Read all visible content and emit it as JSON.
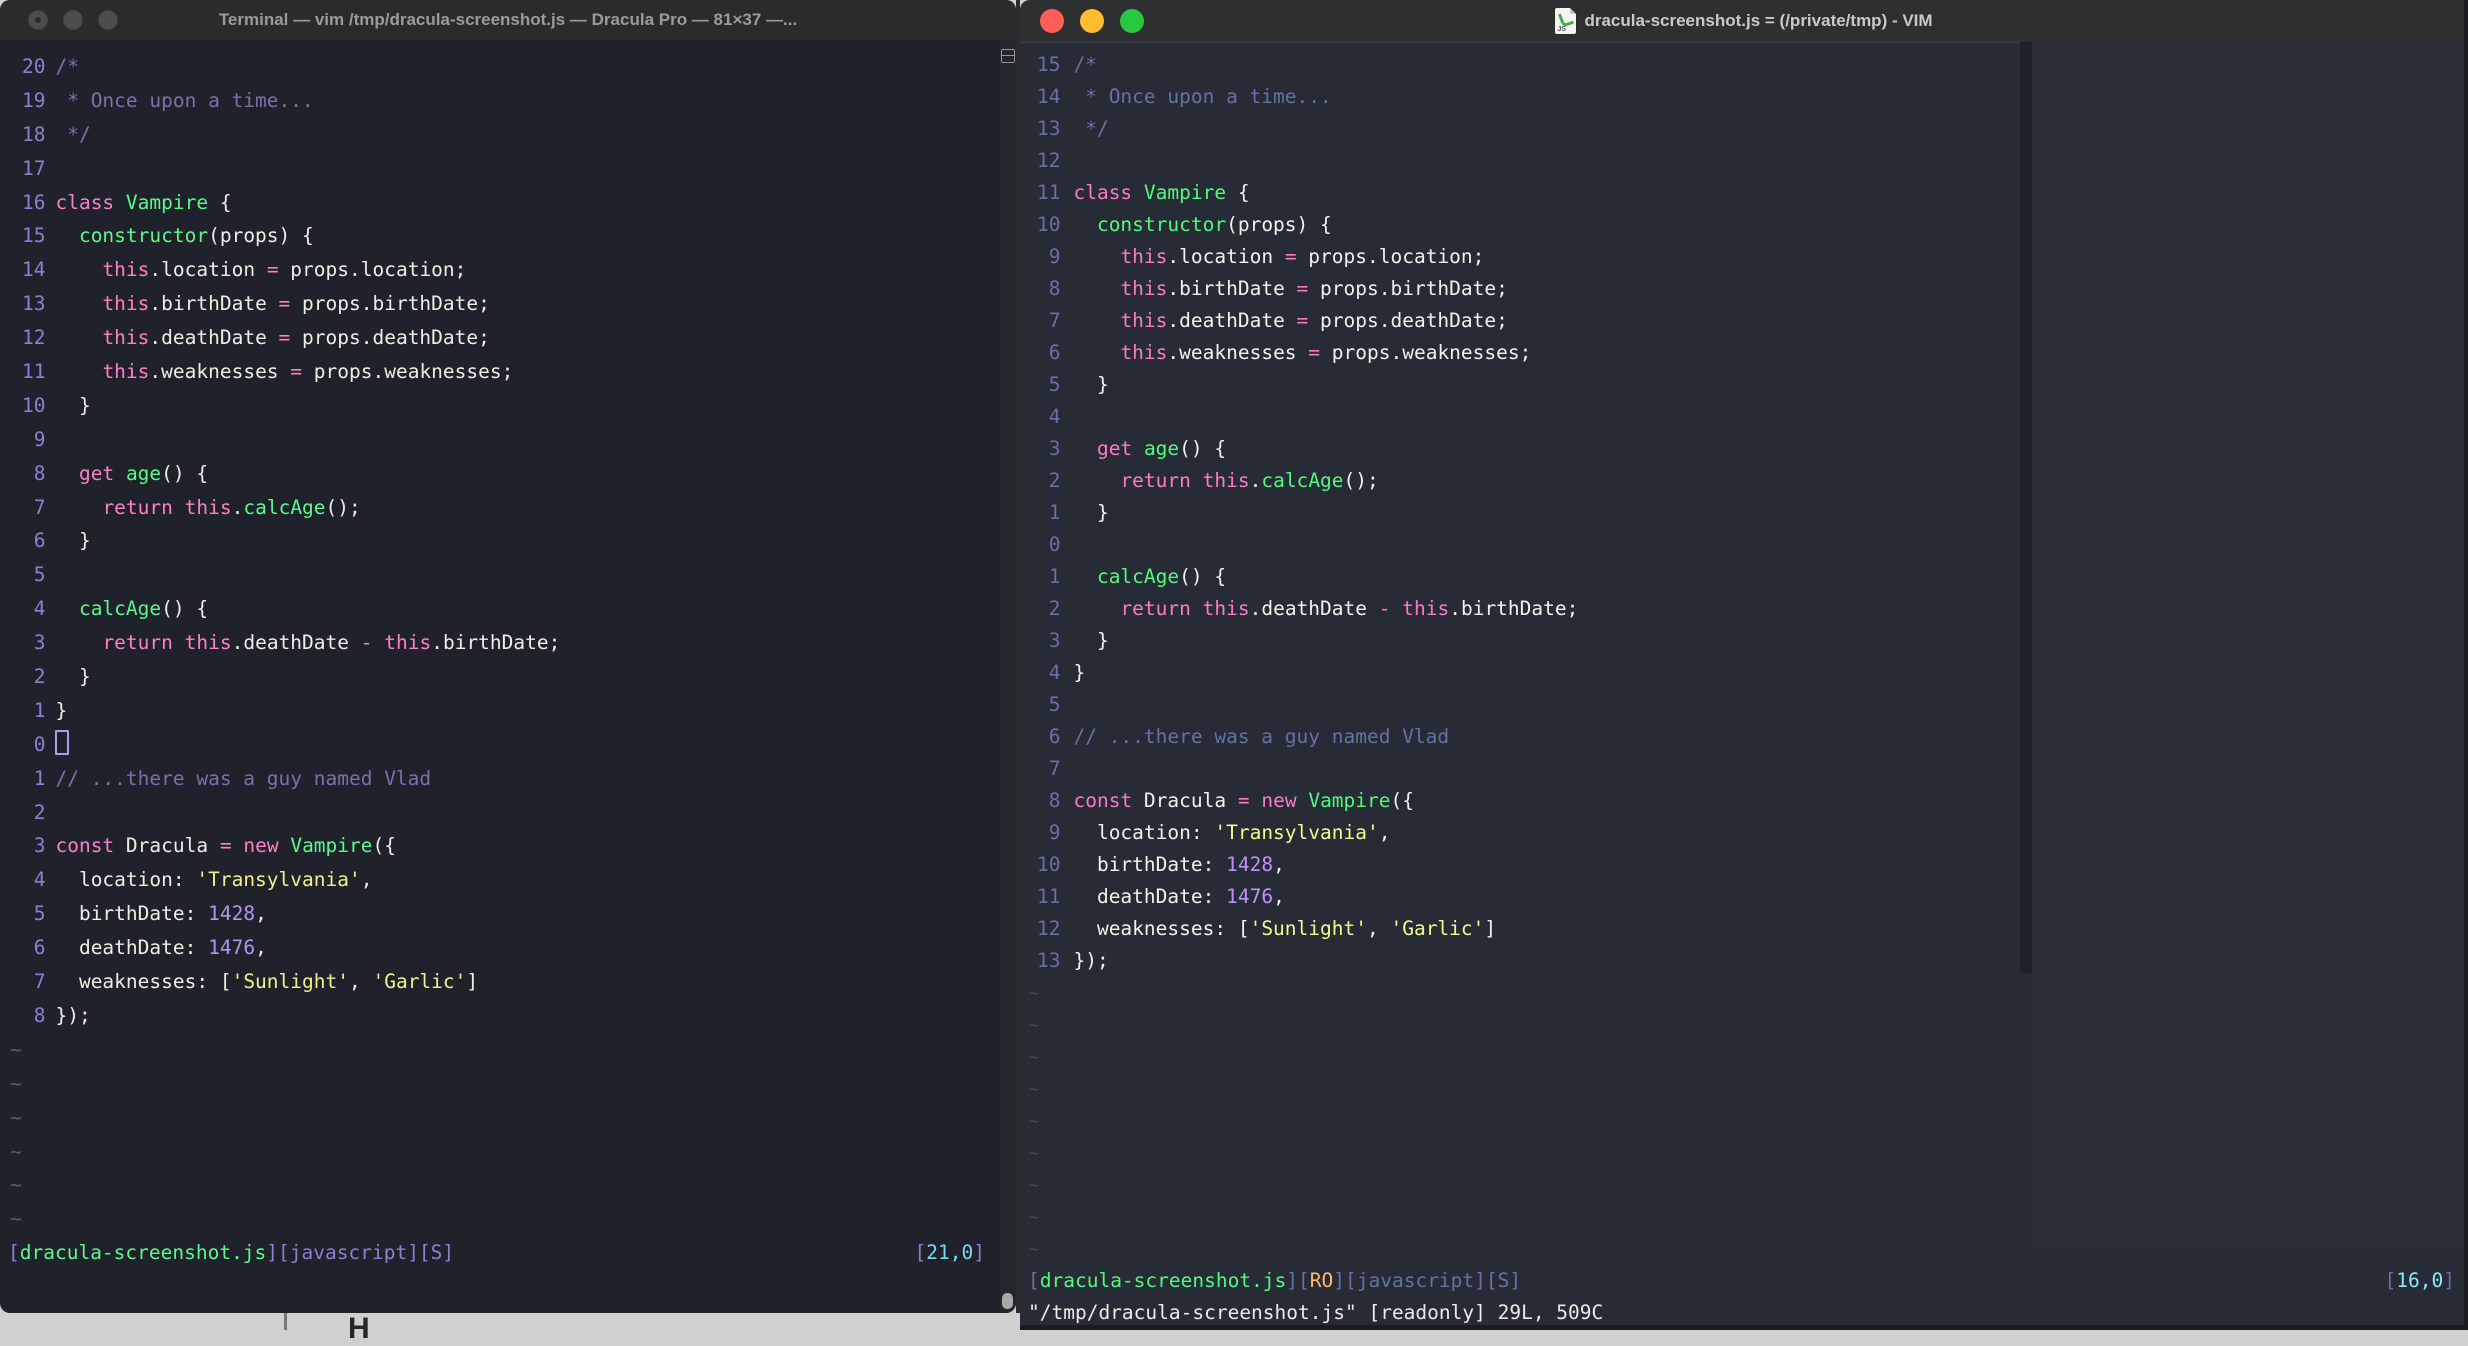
{
  "backdrop": {
    "glyph": "H",
    "background_color": "#D1D0D1"
  },
  "code": {
    "lines": [
      [
        [
          "cm",
          "/*"
        ]
      ],
      [
        [
          "cm",
          " * Once upon a time..."
        ]
      ],
      [
        [
          "cm",
          " */"
        ]
      ],
      [],
      [
        [
          "kw",
          "class"
        ],
        [
          "fg",
          " "
        ],
        [
          "fn",
          "Vampire"
        ],
        [
          "fg",
          " {"
        ]
      ],
      [
        [
          "fg",
          "  "
        ],
        [
          "fn",
          "constructor"
        ],
        [
          "fg",
          "(props) {"
        ]
      ],
      [
        [
          "fg",
          "    "
        ],
        [
          "kw",
          "this"
        ],
        [
          "fg",
          ".location "
        ],
        [
          "kw",
          "="
        ],
        [
          "fg",
          " props.location;"
        ]
      ],
      [
        [
          "fg",
          "    "
        ],
        [
          "kw",
          "this"
        ],
        [
          "fg",
          ".birthDate "
        ],
        [
          "kw",
          "="
        ],
        [
          "fg",
          " props.birthDate;"
        ]
      ],
      [
        [
          "fg",
          "    "
        ],
        [
          "kw",
          "this"
        ],
        [
          "fg",
          ".deathDate "
        ],
        [
          "kw",
          "="
        ],
        [
          "fg",
          " props.deathDate;"
        ]
      ],
      [
        [
          "fg",
          "    "
        ],
        [
          "kw",
          "this"
        ],
        [
          "fg",
          ".weaknesses "
        ],
        [
          "kw",
          "="
        ],
        [
          "fg",
          " props.weaknesses;"
        ]
      ],
      [
        [
          "fg",
          "  }"
        ]
      ],
      [],
      [
        [
          "fg",
          "  "
        ],
        [
          "kw",
          "get"
        ],
        [
          "fg",
          " "
        ],
        [
          "fn",
          "age"
        ],
        [
          "fg",
          "() {"
        ]
      ],
      [
        [
          "fg",
          "    "
        ],
        [
          "kw",
          "return"
        ],
        [
          "fg",
          " "
        ],
        [
          "kw",
          "this"
        ],
        [
          "fg",
          "."
        ],
        [
          "fn",
          "calcAge"
        ],
        [
          "fg",
          "();"
        ]
      ],
      [
        [
          "fg",
          "  }"
        ]
      ],
      [],
      [
        [
          "fg",
          "  "
        ],
        [
          "fn",
          "calcAge"
        ],
        [
          "fg",
          "() {"
        ]
      ],
      [
        [
          "fg",
          "    "
        ],
        [
          "kw",
          "return"
        ],
        [
          "fg",
          " "
        ],
        [
          "kw",
          "this"
        ],
        [
          "fg",
          ".deathDate "
        ],
        [
          "kw",
          "-"
        ],
        [
          "fg",
          " "
        ],
        [
          "kw",
          "this"
        ],
        [
          "fg",
          ".birthDate;"
        ]
      ],
      [
        [
          "fg",
          "  }"
        ]
      ],
      [
        [
          "fg",
          "}"
        ]
      ],
      [],
      [
        [
          "cm",
          "// ...there was a guy named Vlad"
        ]
      ],
      [],
      [
        [
          "kw",
          "const"
        ],
        [
          "fg",
          " Dracula "
        ],
        [
          "kw",
          "="
        ],
        [
          "fg",
          " "
        ],
        [
          "kw",
          "new"
        ],
        [
          "fg",
          " "
        ],
        [
          "fn",
          "Vampire"
        ],
        [
          "fg",
          "({"
        ]
      ],
      [
        [
          "fg",
          "  location: "
        ],
        [
          "str",
          "'Transylvania'"
        ],
        [
          "fg",
          ","
        ]
      ],
      [
        [
          "fg",
          "  birthDate: "
        ],
        [
          "num",
          "1428"
        ],
        [
          "fg",
          ","
        ]
      ],
      [
        [
          "fg",
          "  deathDate: "
        ],
        [
          "num",
          "1476"
        ],
        [
          "fg",
          ","
        ]
      ],
      [
        [
          "fg",
          "  weaknesses: ["
        ],
        [
          "str",
          "'Sunlight'"
        ],
        [
          "fg",
          ", "
        ],
        [
          "str",
          "'Garlic'"
        ],
        [
          "fg",
          "]"
        ]
      ],
      [
        [
          "fg",
          "});"
        ]
      ]
    ]
  },
  "left_window": {
    "titlebar": {
      "title": "Terminal — vim /tmp/dracula-screenshot.js — Dracula Pro — 81×37 —...",
      "lights": [
        "#4D4D50",
        "#4D4D50",
        "#4D4D50"
      ]
    },
    "cursor_line": 20,
    "cursor_visible": true,
    "tilde_count": 6,
    "status": [
      [
        "br",
        "["
      ],
      [
        "file",
        "dracula-screenshot.js"
      ],
      [
        "br",
        "]["
      ],
      [
        "br",
        "javascript"
      ],
      [
        "br",
        "]["
      ],
      [
        "br",
        "S"
      ],
      [
        "br",
        "]"
      ]
    ],
    "ruler": [
      [
        "br",
        "["
      ],
      [
        "rn",
        "21,0"
      ],
      [
        "br",
        "]"
      ]
    ],
    "cmd_line": "",
    "palette": {
      "bg": "#1F222B",
      "fg": "#EFEDE6",
      "kw": "#FF7FC8",
      "fn": "#5CF98A",
      "str": "#EFF18D",
      "num": "#B197EC",
      "cm": "#7A70AC",
      "gutter": "#8B81D4",
      "tilde": "#595E6A",
      "br": "#8A80CF",
      "file": "#5CF98A",
      "rn": "#7ED7F5",
      "cursor": "#A89FE6",
      "cmd": "#EFEDE6"
    }
  },
  "right_window": {
    "titlebar": {
      "title": "dracula-screenshot.js = (/private/tmp) - VIM",
      "icon_label": "JS",
      "lights": [
        "#FF5F57",
        "#FEBC2E",
        "#28C841"
      ]
    },
    "cursor_line": 15,
    "cursor_visible": false,
    "tilde_count": 9,
    "status": [
      [
        "br",
        "["
      ],
      [
        "file",
        "dracula-screenshot.js"
      ],
      [
        "br",
        "]["
      ],
      [
        "ro",
        "RO"
      ],
      [
        "br",
        "]["
      ],
      [
        "br",
        "javascript"
      ],
      [
        "br",
        "]["
      ],
      [
        "br",
        "S"
      ],
      [
        "br",
        "]"
      ]
    ],
    "ruler": [
      [
        "br",
        "["
      ],
      [
        "rn",
        "16,0"
      ],
      [
        "br",
        "]"
      ]
    ],
    "cmd_line": "\"/tmp/dracula-screenshot.js\" [readonly] 29L, 509C",
    "palette": {
      "bg": "#272B36",
      "fg": "#F3F1EA",
      "kw": "#FF79C6",
      "fn": "#50FA7B",
      "str": "#F1FA8C",
      "num": "#BD93F9",
      "cm": "#6272A4",
      "gutter": "#6373A5",
      "tilde": "#3F4557",
      "br": "#6272A4",
      "file": "#50FA7B",
      "ro": "#FFB86C",
      "rn": "#8BE9FD",
      "cursor": "#BD93F9",
      "cmd": "#EDEBE3"
    }
  }
}
